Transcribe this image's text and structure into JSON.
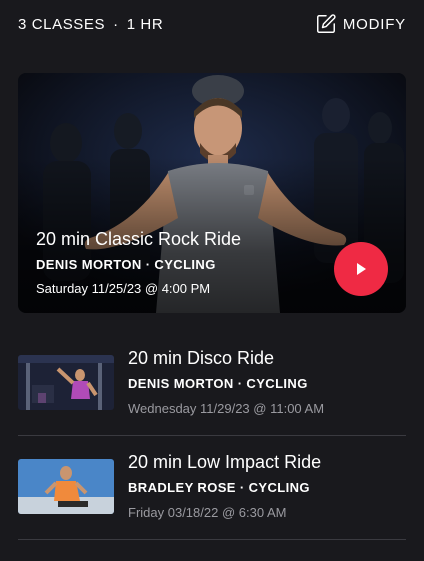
{
  "header": {
    "classes": "3 CLASSES",
    "separator": "·",
    "duration": "1 HR",
    "modify_label": "MODIFY",
    "modify_icon": "edit-icon"
  },
  "featured": {
    "title": "20 min Classic Rock Ride",
    "meta": "DENIS MORTON · CYCLING",
    "date": "Saturday 11/25/23 @ 4:00 PM",
    "play_icon": "play-icon",
    "play_color": "#ef2a44"
  },
  "classes": [
    {
      "title": "20 min Disco Ride",
      "meta": "DENIS MORTON · CYCLING",
      "date": "Wednesday 11/29/23 @ 11:00 AM"
    },
    {
      "title": "20 min Low Impact Ride",
      "meta": "BRADLEY ROSE · CYCLING",
      "date": "Friday 03/18/22 @ 6:30 AM"
    }
  ],
  "colors": {
    "background": "#19191d",
    "accent": "#ef2a44",
    "secondary_text": "#9a9aa0",
    "divider": "#3a3a40"
  }
}
